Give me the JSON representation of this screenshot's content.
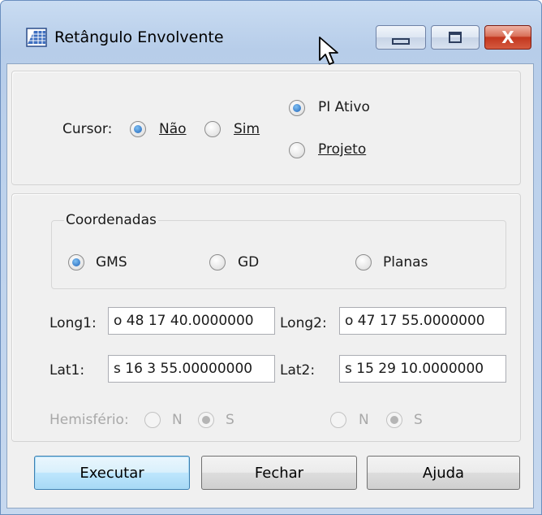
{
  "window": {
    "title": "Retângulo Envolvente",
    "close_glyph": "X"
  },
  "cursor": {
    "label": "Cursor:",
    "options": [
      {
        "label": "Não",
        "selected": true
      },
      {
        "label": "Sim",
        "selected": false
      }
    ]
  },
  "source": {
    "options": [
      {
        "label": "PI Ativo",
        "selected": true
      },
      {
        "label": "Projeto",
        "selected": false
      }
    ]
  },
  "coordenadas": {
    "legend": "Coordenadas",
    "options": [
      {
        "label": "GMS",
        "selected": true
      },
      {
        "label": "GD",
        "selected": false
      },
      {
        "label": "Planas",
        "selected": false
      }
    ]
  },
  "coords": {
    "long1_label": "Long1:",
    "long1_value": "o 48 17 40.0000000",
    "long2_label": "Long2:",
    "long2_value": "o 47 17 55.0000000",
    "lat1_label": "Lat1:",
    "lat1_value": "s 16 3 55.00000000",
    "lat2_label": "Lat2:",
    "lat2_value": "s 15 29 10.0000000"
  },
  "hemisferio": {
    "label": "Hemisfério:",
    "left": [
      {
        "label": "N",
        "selected": false
      },
      {
        "label": "S",
        "selected": true
      }
    ],
    "right": [
      {
        "label": "N",
        "selected": false
      },
      {
        "label": "S",
        "selected": true
      }
    ]
  },
  "buttons": {
    "executar": "Executar",
    "fechar": "Fechar",
    "ajuda": "Ajuda"
  },
  "icons": [
    "app-grid-icon",
    "minimize-icon",
    "maximize-icon",
    "close-icon",
    "mouse-pointer-icon"
  ],
  "colors": {
    "accent": "#1f63b8",
    "close_red": "#c2361e",
    "titlebar": "#b7cde9"
  }
}
